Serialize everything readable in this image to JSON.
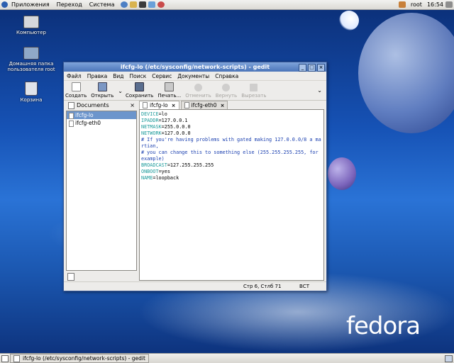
{
  "topbar": {
    "menus": [
      "Приложения",
      "Переход",
      "Система"
    ],
    "user": "root",
    "clock": "16:54"
  },
  "desktop": {
    "icons": [
      {
        "label": "Компьютер",
        "icon": "computer-icon"
      },
      {
        "label": "Домашняя папка пользователя root",
        "icon": "home-folder-icon"
      },
      {
        "label": "Корзина",
        "icon": "trash-icon"
      }
    ],
    "logo": "fedora"
  },
  "window": {
    "title": "ifcfg-lo (/etc/sysconfig/network-scripts) - gedit",
    "menus": [
      "Файл",
      "Правка",
      "Вид",
      "Поиск",
      "Сервис",
      "Документы",
      "Справка"
    ],
    "toolbar": {
      "create": "Создать",
      "open": "Открыть",
      "save": "Сохранить",
      "print": "Печать...",
      "undo": "Отменить",
      "redo": "Вернуть",
      "cut": "Вырезать"
    },
    "side_panel": {
      "title": "Documents",
      "items": [
        "ifcfg-lo",
        "ifcfg-eth0"
      ]
    },
    "tabs": [
      "ifcfg-lo",
      "ifcfg-eth0"
    ],
    "lines": [
      {
        "key": "DEVICE",
        "value": "=lo"
      },
      {
        "key": "IPADDR",
        "value": "=127.0.0.1"
      },
      {
        "key": "NETMASK",
        "value": "=255.0.0.0"
      },
      {
        "key": "NETWORK",
        "value": "=127.0.0.0"
      },
      {
        "comment": "# If you're having problems with gated making 127.0.0.0/8 a martian,"
      },
      {
        "comment": "# you can change this to something else (255.255.255.255, for example)"
      },
      {
        "key": "BROADCAST",
        "value": "=127.255.255.255"
      },
      {
        "key": "ONBOOT",
        "value": "=yes"
      },
      {
        "key": "NAME",
        "value": "=loopback"
      }
    ],
    "status": {
      "position": "Стр 6, Стлб 71",
      "mode": "ВСТ"
    }
  },
  "taskbar": {
    "task": "ifcfg-lo (/etc/sysconfig/network-scripts) - gedit"
  },
  "colors": {
    "title_gradient_top": "#7fa3da",
    "title_gradient_bottom": "#4b75b9",
    "selection": "#6c95cc",
    "key_color": "#1a9a9a",
    "comment_color": "#1b40b0"
  }
}
